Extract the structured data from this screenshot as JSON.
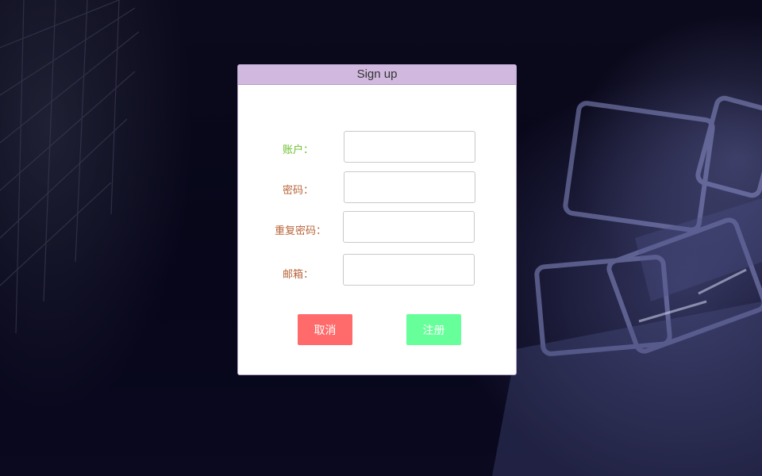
{
  "dialog": {
    "title": "Sign up"
  },
  "form": {
    "fields": [
      {
        "label": "账户：",
        "value": "",
        "placeholder": "",
        "label_color": "#6bbf2a"
      },
      {
        "label": "密码：",
        "value": "",
        "placeholder": "",
        "label_color": "#b8643a"
      },
      {
        "label": "重复密码：",
        "value": "",
        "placeholder": "",
        "label_color": "#b8643a"
      },
      {
        "label": "邮箱：",
        "value": "",
        "placeholder": "",
        "label_color": "#b8643a"
      }
    ]
  },
  "buttons": {
    "cancel": {
      "label": "取消",
      "color": "#ff6b6b"
    },
    "register": {
      "label": "注册",
      "color": "#66ff99"
    }
  }
}
